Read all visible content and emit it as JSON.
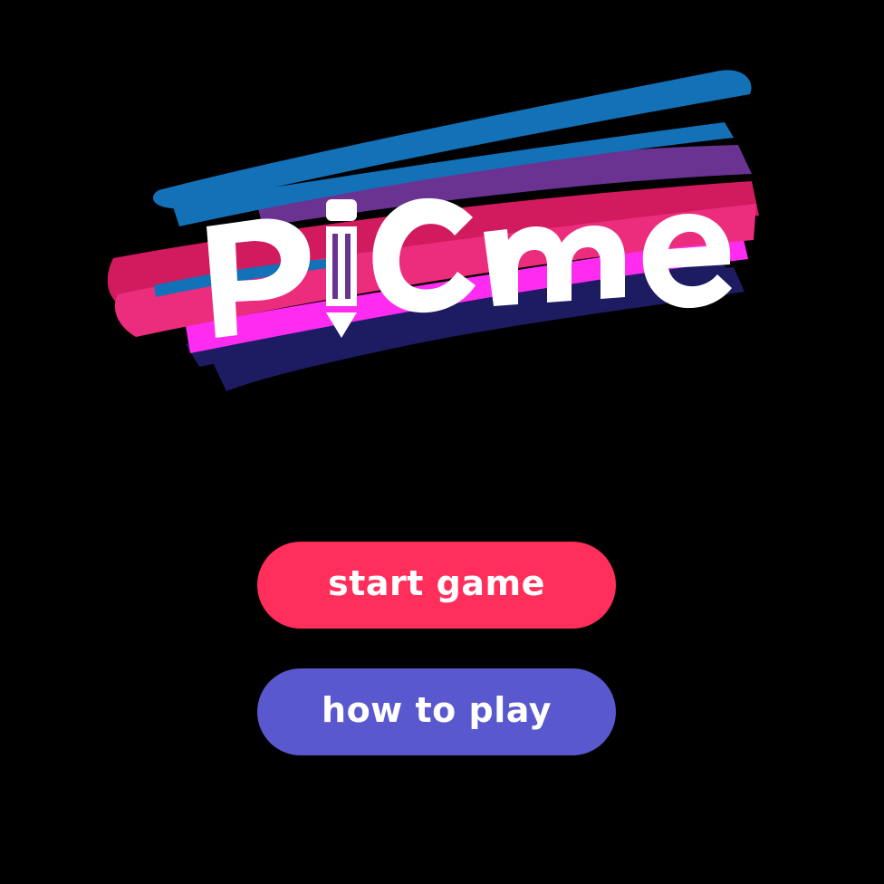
{
  "logo": {
    "wordmark": "PiCme",
    "stroke_colors": {
      "blue": "#1371b8",
      "purple": "#6a3391",
      "pink": "#ec2d7d",
      "crimson": "#d11b5e",
      "magenta": "#ff2bf0",
      "navy": "#1d1b62"
    },
    "icon": "pencil-icon"
  },
  "menu": {
    "start_label": "start game",
    "start_color": "#ff2e5b",
    "howto_label": "how to play",
    "howto_color": "#5a58ce"
  }
}
